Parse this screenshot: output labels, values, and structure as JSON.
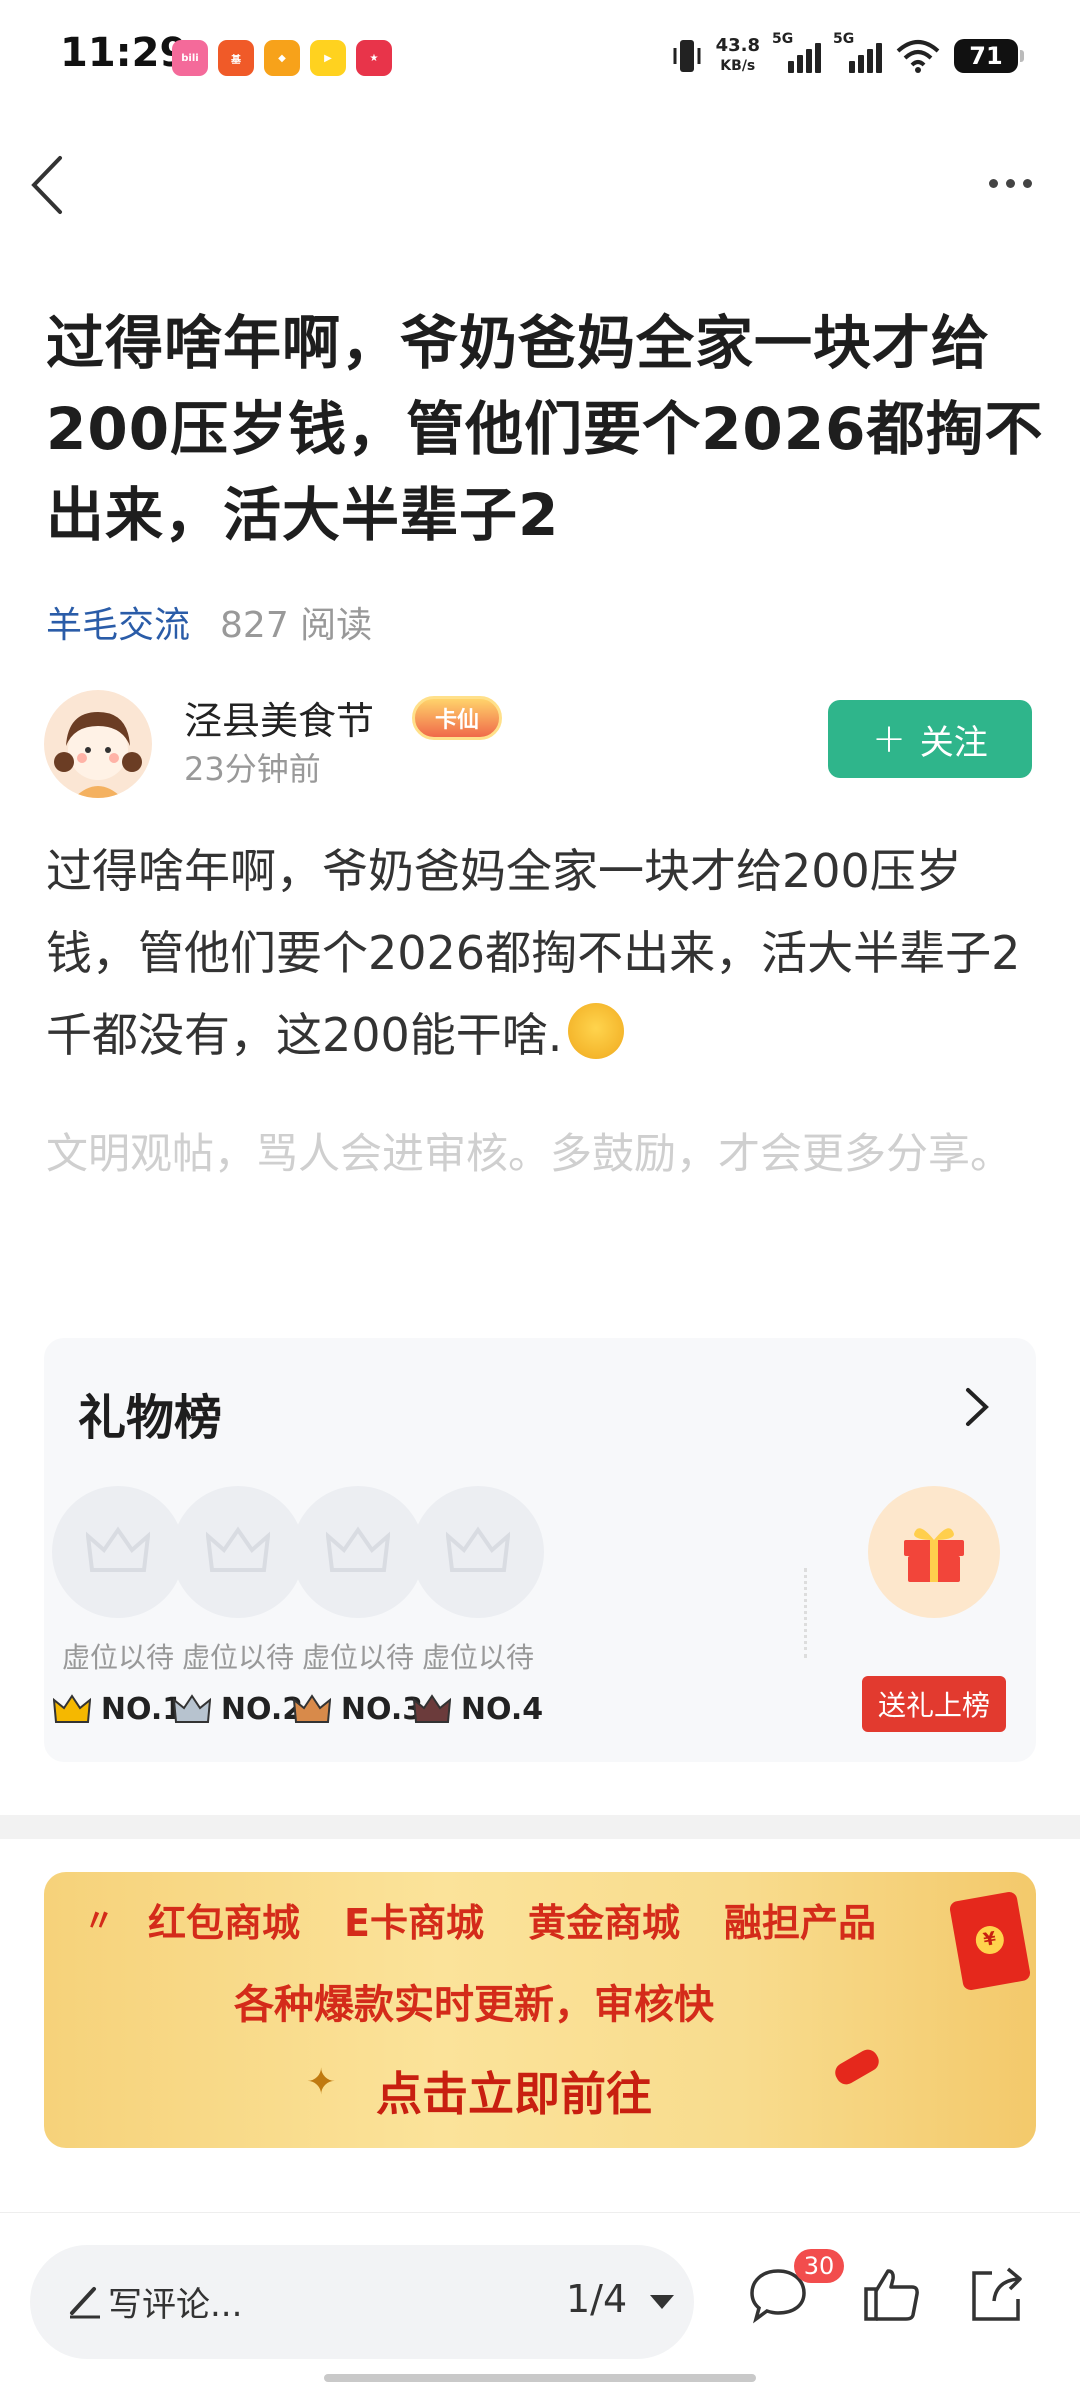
{
  "status_bar": {
    "time": "11:29",
    "net_speed_value": "43.8",
    "net_speed_unit": "KB/s",
    "signal1_label": "5G",
    "signal2_label": "5G",
    "battery": "71",
    "app_icons": [
      "bilibili-icon",
      "fund-icon",
      "meituan-icon",
      "video-icon",
      "game-icon"
    ]
  },
  "nav": {
    "back_icon": "chevron-left-icon",
    "more_icon": "more-dots-icon"
  },
  "post": {
    "title": "过得啥年啊，爷奶爸妈全家一块才给200压岁钱，管他们要个2026都掏不出来，活大半辈子2",
    "forum": "羊毛交流",
    "reads": "827 阅读",
    "author": {
      "name": "泾县美食节",
      "badge": "卡仙",
      "time": "23分钟前",
      "follow_label": "关注"
    },
    "body": "过得啥年啊，爷奶爸妈全家一块才给200压岁钱，管他们要个2026都掏不出来，活大半辈子2千都没有，这200能干啥.",
    "notice": "文明观帖，骂人会进审核。多鼓励，才会更多分享。"
  },
  "gift_board": {
    "title": "礼物榜",
    "slots": [
      {
        "placeholder": "虚位以待",
        "rank": "NO.1",
        "crown_color": "#f5b800"
      },
      {
        "placeholder": "虚位以待",
        "rank": "NO.2",
        "crown_color": "#b7c3cf"
      },
      {
        "placeholder": "虚位以待",
        "rank": "NO.3",
        "crown_color": "#d88a4a"
      },
      {
        "placeholder": "虚位以待",
        "rank": "NO.4",
        "crown_color": "#6b3b3b"
      }
    ],
    "send_gift_label": "送礼上榜"
  },
  "banner": {
    "items": [
      "红包商城",
      "E卡商城",
      "黄金商城",
      "融担产品"
    ],
    "subtitle": "各种爆款实时更新，审核快",
    "cta": "点击立即前往"
  },
  "bottom_bar": {
    "comment_placeholder": "写评论...",
    "page_indicator": "1/4",
    "comment_count": "30"
  }
}
